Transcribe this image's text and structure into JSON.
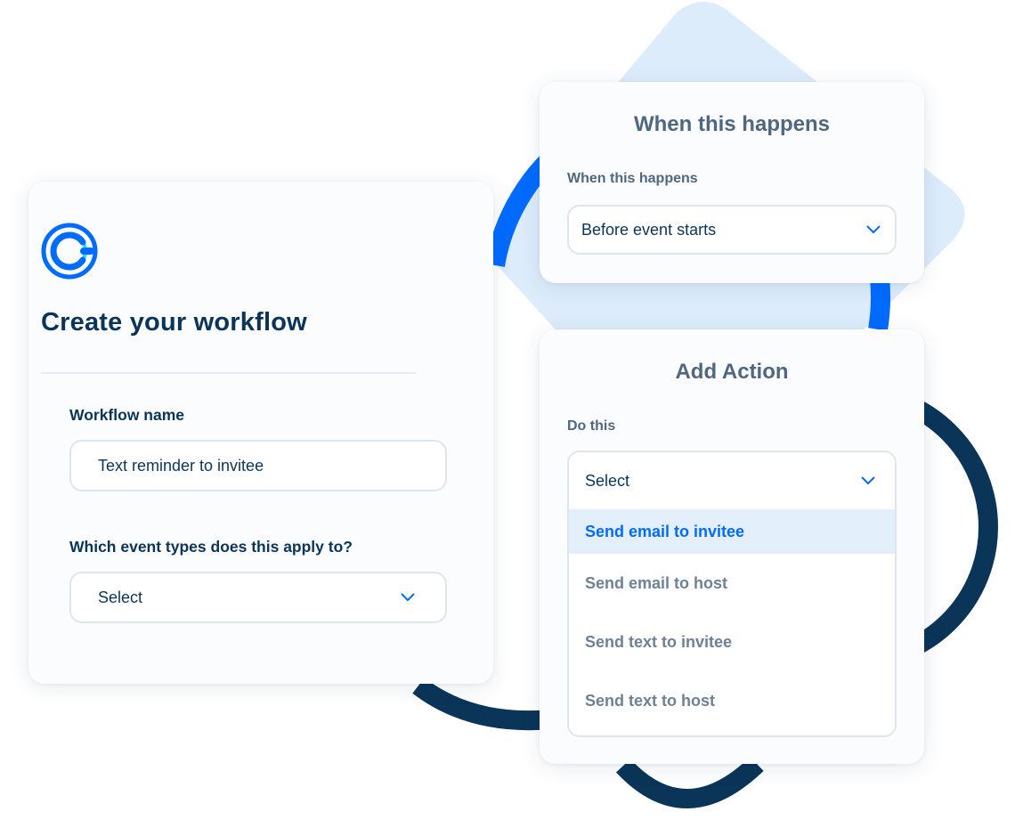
{
  "colors": {
    "navy": "#0b3558",
    "brand_blue": "#006bff",
    "light_blue_shape": "#dcecfb",
    "highlight": "#e3f0fc",
    "muted_text": "#6e8195"
  },
  "icons": {
    "logo": "calendly-logo-icon",
    "chevron": "chevron-down-icon"
  },
  "create_card": {
    "title": "Create your workflow",
    "workflow_name_label": "Workflow name",
    "workflow_name_value": "Text reminder to invitee",
    "event_types_label": "Which event types does this apply to?",
    "event_types_value": "Select"
  },
  "trigger_card": {
    "title": "When this happens",
    "label": "When this happens",
    "selected": "Before event starts"
  },
  "action_card": {
    "title": "Add Action",
    "label": "Do this",
    "selected": "Select",
    "options": [
      {
        "label": "Send email to invitee",
        "highlighted": true
      },
      {
        "label": "Send email to host",
        "highlighted": false
      },
      {
        "label": "Send text to invitee",
        "highlighted": false
      },
      {
        "label": "Send text to host",
        "highlighted": false
      }
    ]
  }
}
